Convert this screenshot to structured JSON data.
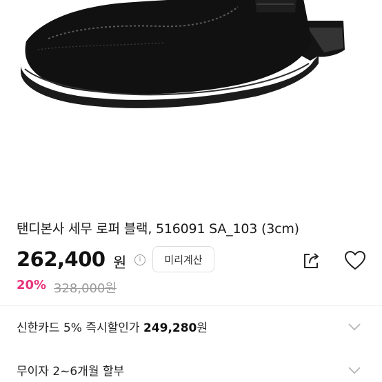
{
  "product": {
    "title": "탠디본사 세무 로퍼 블랙, 516091 SA_103 (3cm)",
    "price": "262,400",
    "price_unit": "원",
    "discount_rate": "20%",
    "original_price": "328,000원"
  },
  "actions": {
    "calc_label": "미리계산"
  },
  "card_offer": {
    "prefix": "신한카드 5% 즉시할인가 ",
    "price": "249,280",
    "unit": "원"
  },
  "installment": {
    "text": "무이자 2~6개월 할부"
  },
  "icons": {
    "info": "info-icon",
    "share": "share-icon",
    "wishlist": "heart-icon",
    "expand": "chevron-down-icon"
  },
  "colors": {
    "discount": "#e8337a",
    "price": "#111111",
    "muted": "#9a9a9a"
  }
}
